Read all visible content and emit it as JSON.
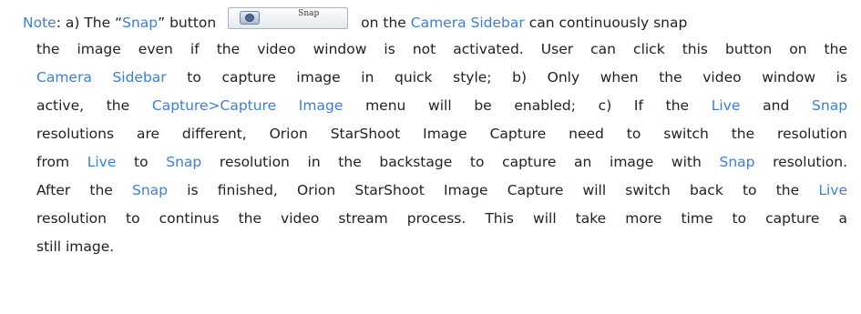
{
  "note": {
    "label": "Note",
    "a_prefix": ": a) The “",
    "snap_quoted": "Snap",
    "a_after_quote": "” button",
    "button_label": "Snap",
    "a_on_the": "on the",
    "camera_sidebar": "Camera Sidebar",
    "a_can_snap": "can continuously snap",
    "line2": "the image even if the video window is not activated. User can click this button on the",
    "camera_sidebar_2": "Camera Sidebar",
    "line3_rest": "to capture image in quick style; b) Only when the video window is",
    "line4_pre": "active, the",
    "capture_menu": "Capture>Capture Image",
    "line4_post": "menu will be enabled; c) If the",
    "live": "Live",
    "and": "and",
    "snap": "Snap",
    "line5": "resolutions are different, Orion StarShoot Image Capture need to switch the resolution",
    "from": "from",
    "to": "to",
    "line6_mid": "resolution in the backstage to capture an image with",
    "line6_end": "resolution.",
    "line7_pre": "After the",
    "line7_mid": "is finished, Orion StarShoot Image Capture will switch back to the",
    "line8": "resolution to continus the video stream process. This will take more time to capture a",
    "line9": "still image."
  },
  "colors": {
    "highlight": "#3a7fd8",
    "text": "#222222"
  }
}
